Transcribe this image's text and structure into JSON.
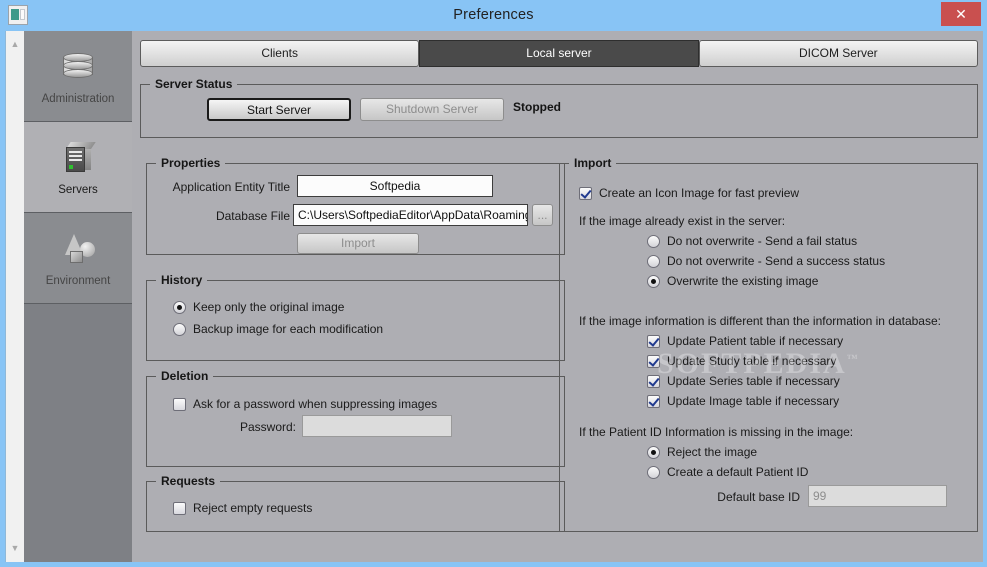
{
  "window": {
    "title": "Preferences",
    "app_icon": "app-window-icon",
    "close_label": "✕"
  },
  "sidebar": {
    "items": [
      {
        "label": "Administration",
        "icon": "database-icon",
        "selected": false
      },
      {
        "label": "Servers",
        "icon": "server-icon",
        "selected": true
      },
      {
        "label": "Environment",
        "icon": "shapes-icon",
        "selected": false
      }
    ],
    "scroll_up": "▲",
    "scroll_down": "▼"
  },
  "tabs": [
    {
      "label": "Clients",
      "active": false
    },
    {
      "label": "Local server",
      "active": true
    },
    {
      "label": "DICOM Server",
      "active": false
    }
  ],
  "server_status": {
    "caption": "Server Status",
    "start_label": "Start Server",
    "shutdown_label": "Shutdown Server",
    "status": "Stopped"
  },
  "properties": {
    "caption": "Properties",
    "aet_label": "Application Entity Title",
    "aet_value": "Softpedia",
    "db_label": "Database File",
    "db_value": "C:\\Users\\SoftpediaEditor\\AppData\\Roaming\\Dig",
    "browse_label": "...",
    "import_label": "Import"
  },
  "history": {
    "caption": "History",
    "options": [
      {
        "label": "Keep only the original image",
        "selected": true
      },
      {
        "label": "Backup image for each modification",
        "selected": false
      }
    ]
  },
  "deletion": {
    "caption": "Deletion",
    "ask_password_label": "Ask for a password when suppressing images",
    "ask_password_checked": false,
    "password_label": "Password:",
    "password_value": ""
  },
  "requests": {
    "caption": "Requests",
    "reject_empty_label": "Reject empty requests",
    "reject_empty_checked": false
  },
  "import": {
    "caption": "Import",
    "icon_preview_label": "Create an Icon Image for fast preview",
    "icon_preview_checked": true,
    "exists_heading": "If the image already exist in the server:",
    "exists_options": [
      {
        "label": "Do not overwrite - Send a fail status",
        "selected": false
      },
      {
        "label": "Do not overwrite - Send a success status",
        "selected": false
      },
      {
        "label": "Overwrite the existing image",
        "selected": true
      }
    ],
    "different_heading": "If the image information is different than the information in database:",
    "update_options": [
      {
        "label": "Update Patient table if necessary",
        "checked": true
      },
      {
        "label": "Update Study table if necessary",
        "checked": true
      },
      {
        "label": "Update Series table if necessary",
        "checked": true
      },
      {
        "label": "Update Image table if necessary",
        "checked": true
      }
    ],
    "missing_heading": "If the Patient ID Information is missing in the image:",
    "missing_options": [
      {
        "label": "Reject the image",
        "selected": true
      },
      {
        "label": "Create a default Patient ID",
        "selected": false
      }
    ],
    "default_base_id_label": "Default base ID",
    "default_base_id_placeholder": "99",
    "default_base_id_value": ""
  },
  "watermark": {
    "text": "SOFTPEDIA",
    "mark": "™"
  },
  "colors": {
    "titlebar": "#88c4f5",
    "panel": "#aeaeb3",
    "sidebar": "#7e8085",
    "sidebar_selected": "#b0b0b4",
    "tab_active": "#4a4a4a",
    "close_button": "#c9504f"
  }
}
